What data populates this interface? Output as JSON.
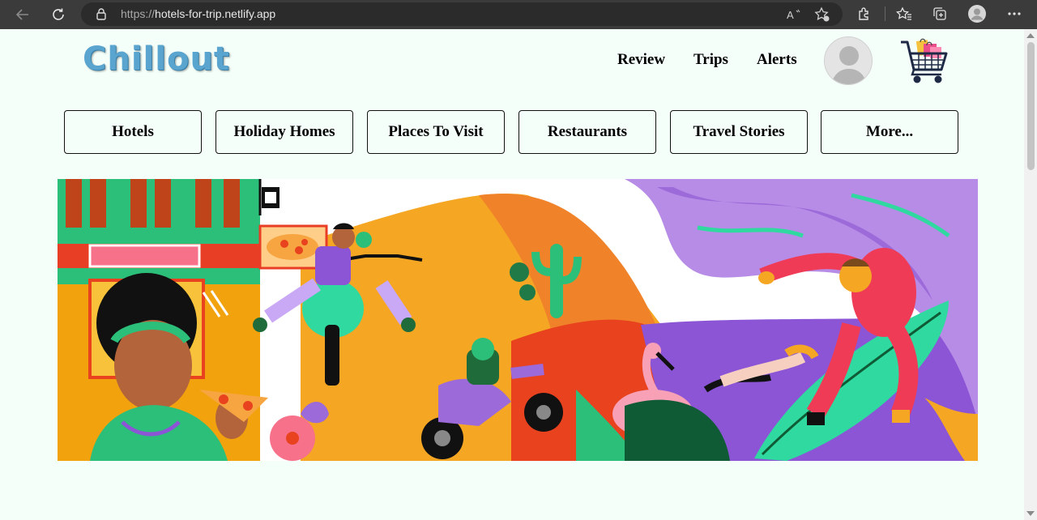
{
  "browser": {
    "url_protocol": "https://",
    "url_host": "hotels-for-trip.netlify.app"
  },
  "header": {
    "logo": "Chillout",
    "nav": [
      "Review",
      "Trips",
      "Alerts"
    ]
  },
  "categories": [
    "Hotels",
    "Holiday Homes",
    "Places To Visit",
    "Restaurants",
    "Travel Stories",
    "More..."
  ],
  "icons": {
    "back": "back-arrow-icon",
    "refresh": "refresh-icon",
    "lock": "lock-icon",
    "read_aloud": "read-aloud-icon",
    "favorite_add": "add-favorite-icon",
    "extensions": "extensions-icon",
    "favorites": "favorites-icon",
    "collections": "collections-icon",
    "profile": "profile-icon",
    "menu": "more-menu-icon",
    "avatar": "user-avatar-icon",
    "cart": "shopping-cart-icon"
  },
  "colors": {
    "page_bg": "#f5fffa",
    "logo": "#5aa5cf",
    "chrome": "#3b3b3b"
  }
}
